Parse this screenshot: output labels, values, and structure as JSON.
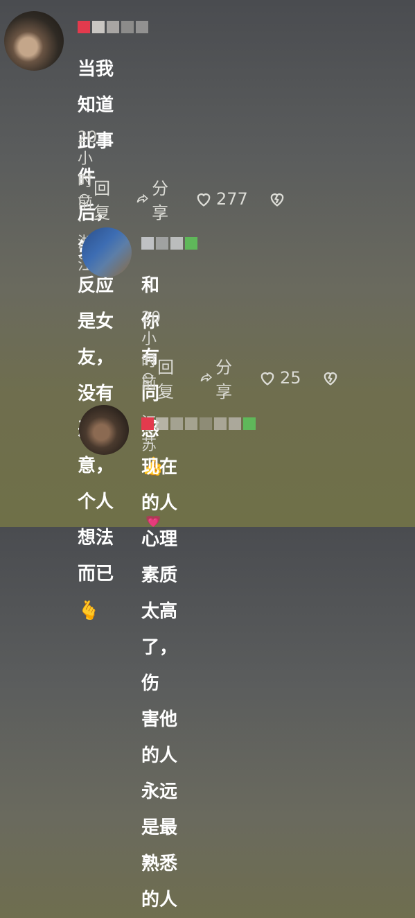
{
  "comments": [
    {
      "text_line1": "当我知道此事件后，第一反应是女",
      "text_line2": "友，没有恶意，个人想法而已",
      "emoji": "🫰",
      "meta": "20小时前·浙江",
      "reply": "回复",
      "share": "分享",
      "likes": "277"
    },
    {
      "text_line1": "和你有同感",
      "emoji": "👍",
      "meta": "20小时前·江苏",
      "reply": "回复",
      "share": "分享",
      "likes": "25"
    },
    {
      "text_line1": "现在的人心理素质太高了，伤",
      "text_line2": "害他的人永远是最熟悉的人",
      "emoji": "💗"
    }
  ],
  "colors": {
    "accent_red": "#e8394c",
    "accent_green": "#5fb85a"
  },
  "icons": [
    "comment-icon",
    "share-icon",
    "heart-icon",
    "broken-heart-icon"
  ]
}
